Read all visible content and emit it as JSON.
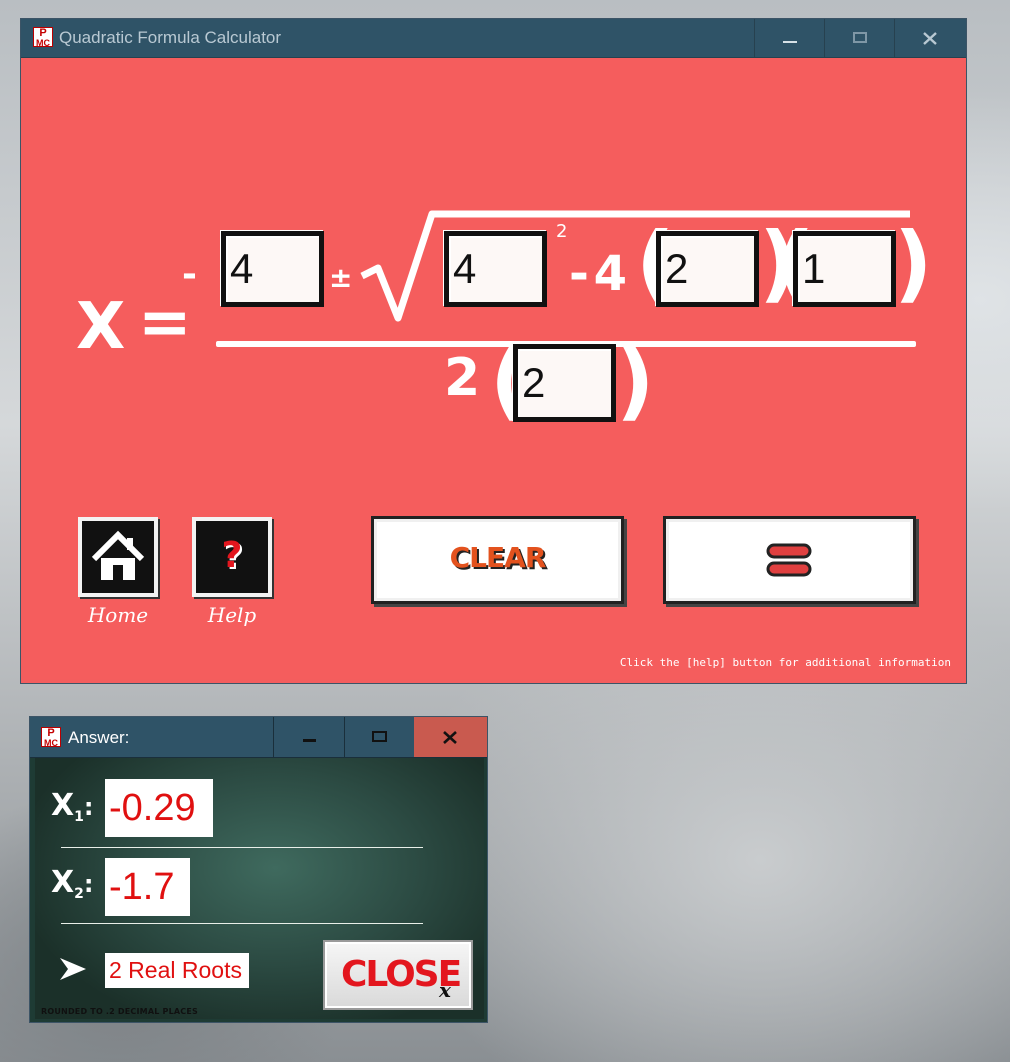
{
  "main_window": {
    "title": "Quadratic Formula Calculator",
    "icon_text_top": "P",
    "icon_text_bottom": "MC",
    "controls": {
      "minimize": "_",
      "maximize": "□",
      "close": "X"
    }
  },
  "formula": {
    "x_label": "X",
    "equals": "=",
    "neg_sign": "-",
    "plus_minus": "±",
    "exponent": "2",
    "minus_four": "- 4",
    "two": "2",
    "inputs": {
      "neg_b": "4",
      "b": "4",
      "a": "2",
      "c": "1",
      "denominator_a": "2"
    }
  },
  "buttons": {
    "home_label": "Home",
    "help_label": "Help",
    "help_glyph": "?",
    "clear_label": "CLEAR",
    "equals_label": "="
  },
  "hint": "Click the [help] button for additional information",
  "answer_window": {
    "title": "Answer:",
    "x1_label": "X",
    "x1_sub": "1",
    "x2_label": "X",
    "x2_sub": "2",
    "colon": ":",
    "x1_value": "-0.29",
    "x2_value": "-1.7",
    "root_type": "2 Real Roots",
    "close_label": "CLOSE",
    "close_mark": "x",
    "footnote": "Rounded to .2 decimal places"
  },
  "colors": {
    "canvas": "#f55d5d",
    "titlebar": "#2f5367",
    "chalkboard": "#2c4b43",
    "answer_red": "#e01010",
    "close_hover": "#c95a4f"
  }
}
